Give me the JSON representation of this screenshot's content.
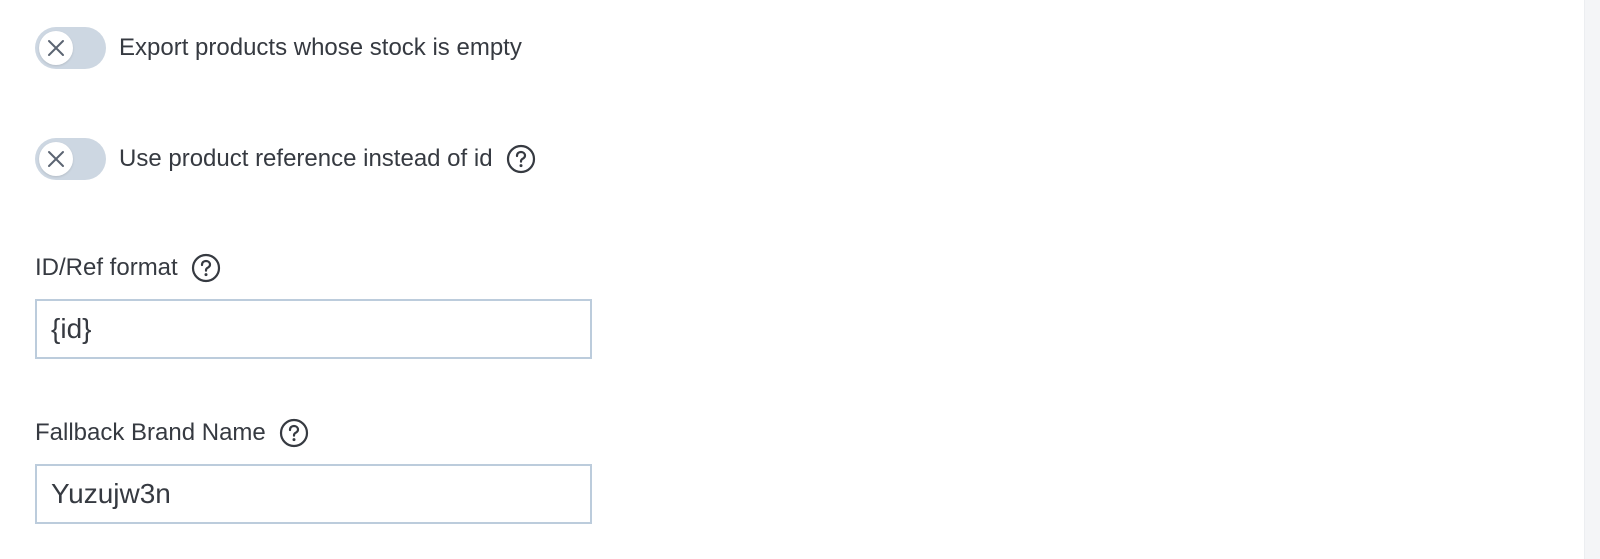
{
  "toggles": [
    {
      "label": "Export products whose stock is empty",
      "state": "off",
      "has_help": false
    },
    {
      "label": "Use product reference instead of id",
      "state": "off",
      "has_help": true
    }
  ],
  "fields": [
    {
      "label": "ID/Ref format",
      "value": "{id}"
    },
    {
      "label": "Fallback Brand Name",
      "value": "Yuzujw3n"
    }
  ],
  "icons": {
    "toggle_knob": "close-icon",
    "help": "question-circle-icon"
  },
  "colors": {
    "text": "#363a41",
    "toggle_off": "#cdd7e2",
    "input_border": "#bcccdc"
  }
}
